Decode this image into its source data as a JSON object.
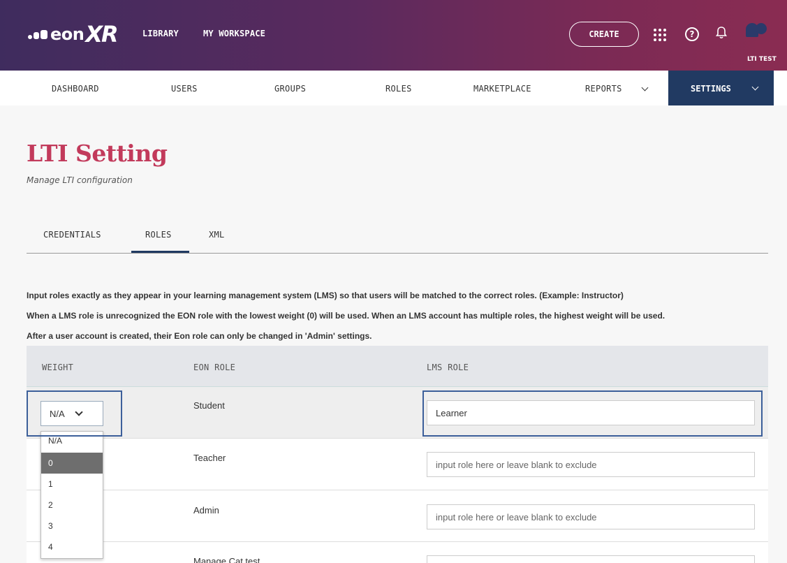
{
  "header": {
    "logo_eon": "eon",
    "logo_xr": "XR",
    "links": [
      "LIBRARY",
      "MY WORKSPACE"
    ],
    "create_label": "CREATE",
    "help_glyph": "?",
    "bell_glyph": "🔔",
    "avatar_label": "LTI TEST"
  },
  "nav": {
    "items": [
      "DASHBOARD",
      "USERS",
      "GROUPS",
      "ROLES",
      "MARKETPLACE",
      "REPORTS"
    ],
    "active": "SETTINGS",
    "active_bg": "#213a62"
  },
  "page": {
    "title": "LTI Setting",
    "subtitle": "Manage LTI configuration",
    "title_color": "#c23a5b"
  },
  "tabs": [
    "CREDENTIALS",
    "ROLES",
    "XML"
  ],
  "active_tab": "ROLES",
  "instructions": [
    "Input roles exactly as they appear in your learning management system (LMS) so that users will be matched to the correct roles. (Example: Instructor)",
    "When a LMS role is unrecognized the EON role with the lowest weight (0) will be used. When an LMS account has multiple roles, the highest weight will be used.",
    "After a user account is created, their Eon role can only be changed in 'Admin' settings."
  ],
  "table": {
    "headers": [
      "WEIGHT",
      "EON ROLE",
      "LMS ROLE"
    ],
    "rows": [
      {
        "weight": "N/A",
        "eon_role": "Student",
        "lms_value": "Learner",
        "placeholder": ""
      },
      {
        "weight": "",
        "eon_role": "Teacher",
        "lms_value": "",
        "placeholder": "input role here or leave blank to exclude"
      },
      {
        "weight": "",
        "eon_role": "Admin",
        "lms_value": "",
        "placeholder": "input role here or leave blank to exclude"
      },
      {
        "weight": "",
        "eon_role": "Manage Cat test",
        "lms_value": "",
        "placeholder": ""
      }
    ]
  },
  "weight_dropdown": {
    "selected": "N/A",
    "options": [
      "N/A",
      "0",
      "1",
      "2",
      "3",
      "4"
    ],
    "highlighted": "0"
  }
}
